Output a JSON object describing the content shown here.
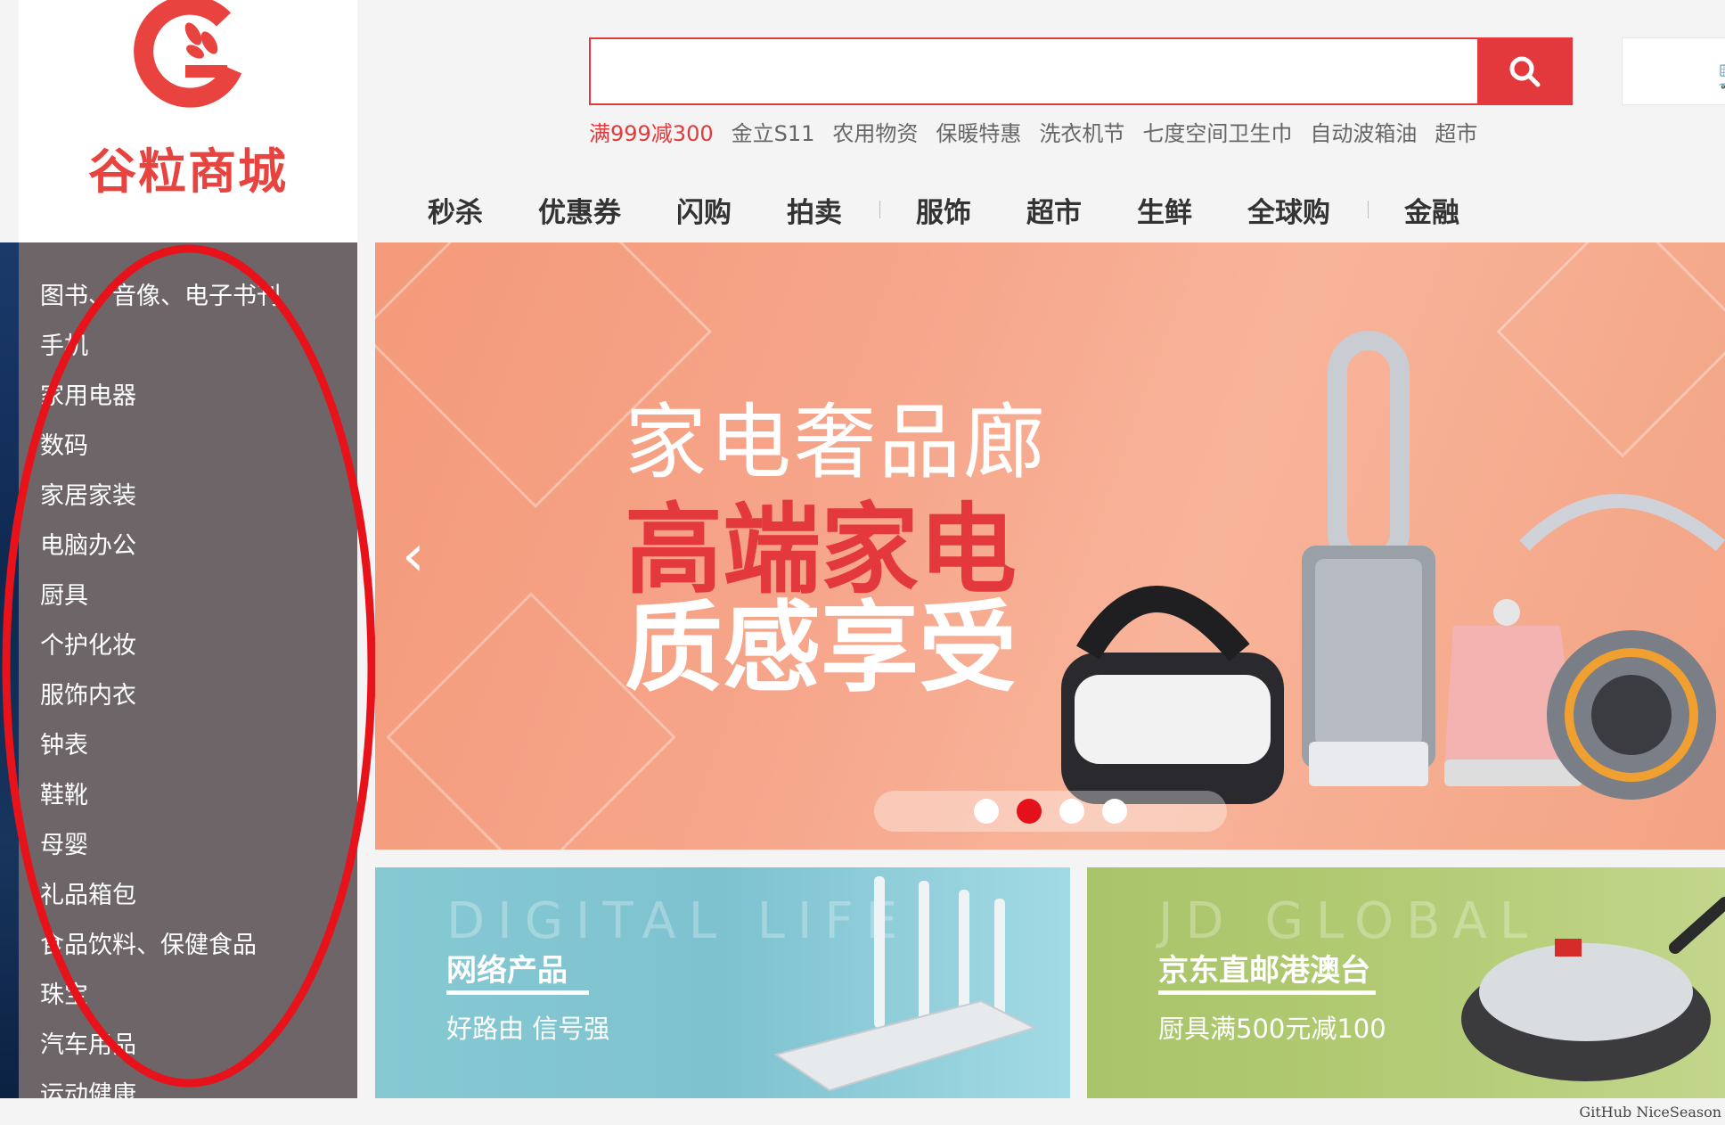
{
  "logo": {
    "text": "谷粒商城"
  },
  "search": {
    "placeholder": "",
    "button_icon": "search-icon"
  },
  "cart": {
    "icon": "cart-icon"
  },
  "hotwords": [
    "满999减300",
    "金立S11",
    "农用物资",
    "保暖特惠",
    "洗衣机节",
    "七度空间卫生巾",
    "自动波箱油",
    "超市"
  ],
  "nav": {
    "group1": [
      "秒杀",
      "优惠券",
      "闪购",
      "拍卖"
    ],
    "group2": [
      "服饰",
      "超市",
      "生鲜",
      "全球购"
    ],
    "group3": [
      "金融"
    ]
  },
  "sidebar": {
    "items": [
      "图书、音像、电子书刊",
      "手机",
      "家用电器",
      "数码",
      "家居家装",
      "电脑办公",
      "厨具",
      "个护化妆",
      "服饰内衣",
      "钟表",
      "鞋靴",
      "母婴",
      "礼品箱包",
      "食品饮料、保健食品",
      "珠宝",
      "汽车用品",
      "运动健康"
    ]
  },
  "banner": {
    "title1": "家电奢品廊",
    "title2": "高端家电",
    "title3": "质感享受",
    "dots_total": 4,
    "active_dot": 2
  },
  "sub_banner_1": {
    "en": "DIGITAL LIFE",
    "cn": "网络产品",
    "desc": "好路由 信号强"
  },
  "sub_banner_2": {
    "en": "JD GLOBAL",
    "cn": "京东直邮港澳台",
    "desc": "厨具满500元减100"
  },
  "footer": {
    "note": "GitHub NiceSeason"
  },
  "colors": {
    "brand_red": "#e4393c",
    "sidebar_bg": "#6e6568",
    "annotation_red": "#e8121b"
  }
}
